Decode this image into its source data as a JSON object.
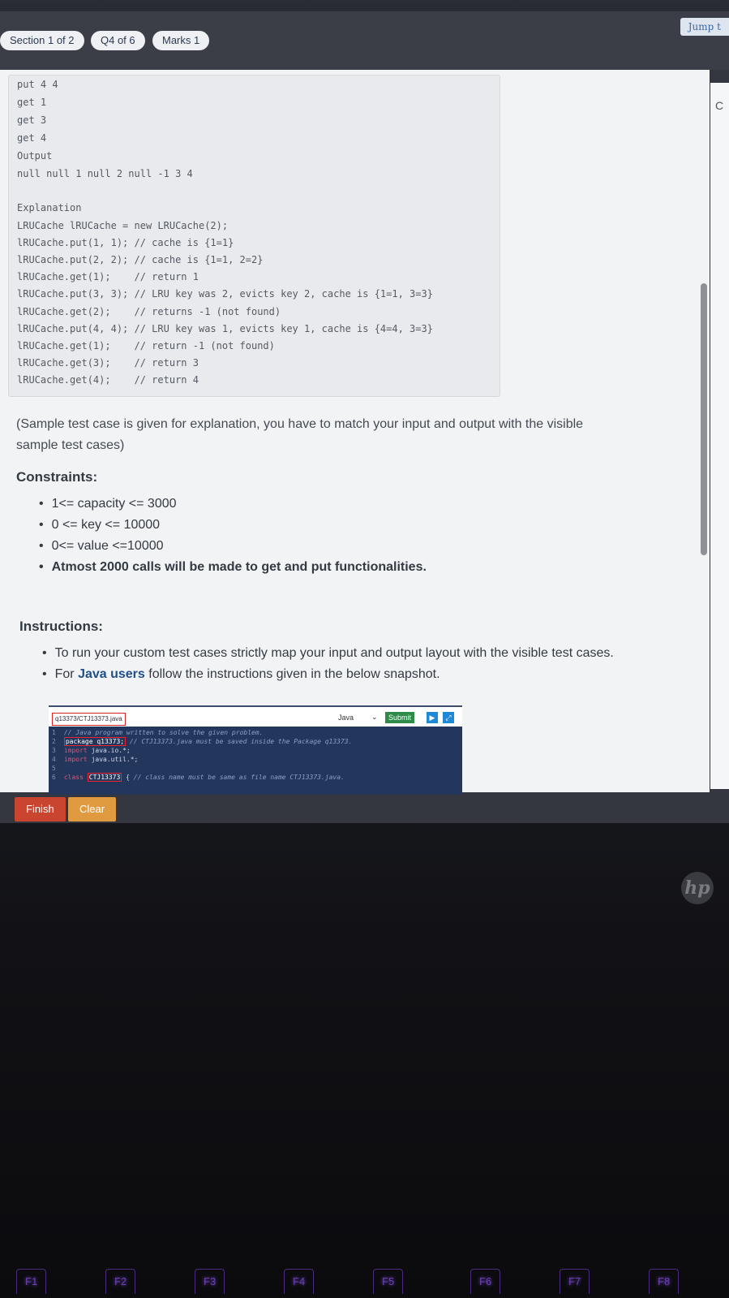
{
  "header": {
    "section": "Section 1 of 2",
    "question": "Q4 of 6",
    "marks": "Marks 1",
    "jump": "Jump t"
  },
  "code_sample": [
    "put 4 4",
    "get 1",
    "get 3",
    "get 4",
    "Output",
    "null null 1 null 2 null -1 3 4",
    "",
    "Explanation",
    "LRUCache lRUCache = new LRUCache(2);",
    "lRUCache.put(1, 1); // cache is {1=1}",
    "lRUCache.put(2, 2); // cache is {1=1, 2=2}",
    "lRUCache.get(1);    // return 1",
    "lRUCache.put(3, 3); // LRU key was 2, evicts key 2, cache is {1=1, 3=3}",
    "lRUCache.get(2);    // returns -1 (not found)",
    "lRUCache.put(4, 4); // LRU key was 1, evicts key 1, cache is {4=4, 3=3}",
    "lRUCache.get(1);    // return -1 (not found)",
    "lRUCache.get(3);    // return 3",
    "lRUCache.get(4);    // return 4"
  ],
  "sample_note_1": "(Sample test case is given for explanation, you have to match your input and output with the visible",
  "sample_note_2": "sample test cases)",
  "constraints": {
    "title": "Constraints:",
    "items": [
      "1<= capacity <= 3000",
      "0 <= key <= 10000",
      "0<= value <=10000",
      "Atmost 2000 calls will be made to get and put functionalities."
    ]
  },
  "instructions": {
    "title": "Instructions:",
    "item1": "To run your custom test cases strictly map your input and output layout with the visible test cases.",
    "item2_prefix": "For",
    "item2_bold": "Java users",
    "item2_suffix": "follow the instructions given in the below snapshot."
  },
  "snapshot": {
    "file": "q13373/CTJ13373.java",
    "language": "Java",
    "submit": "Submit",
    "lines": {
      "l1_num": "1",
      "l1_comment": "// Java program written to solve the given problem.",
      "l2_num": "2",
      "l2_package": "package q13373;",
      "l2_comment": "// CTJ13373.java must be saved inside the Package q13373.",
      "l3_num": "3",
      "l3_kw": "import",
      "l3_rest": "java.io.*;",
      "l4_num": "4",
      "l4_kw": "import",
      "l4_rest": "java.util.*;",
      "l5_num": "5",
      "l6_num": "6",
      "l6_kw": "class",
      "l6_class": "CTJ13373",
      "l6_brace": "{",
      "l6_comment": "// class name must be same as file name CTJ13373.java."
    }
  },
  "buttons": {
    "finish": "Finish",
    "clear": "Clear"
  },
  "keyboard": {
    "keys": [
      "F1",
      "F2",
      "F3",
      "F4",
      "F5",
      "F6",
      "F7",
      "F8"
    ]
  },
  "logo": "hp"
}
